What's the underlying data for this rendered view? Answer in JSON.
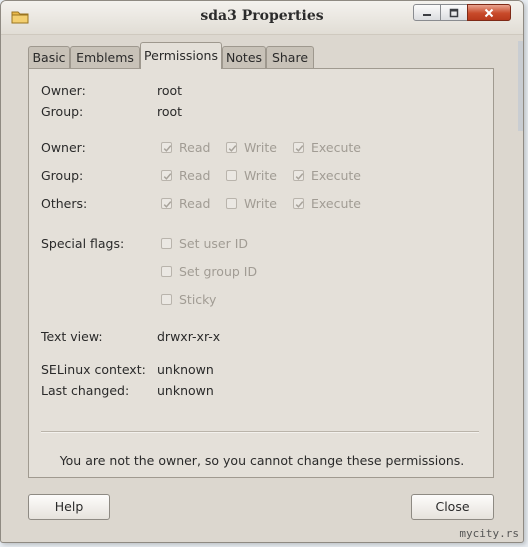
{
  "window": {
    "title": "sda3 Properties",
    "icon": "folder-icon",
    "controls": [
      "minimize-icon",
      "maximize-icon",
      "close-icon"
    ]
  },
  "tabs": [
    {
      "label": "Basic",
      "active": false
    },
    {
      "label": "Emblems",
      "active": false
    },
    {
      "label": "Permissions",
      "active": true
    },
    {
      "label": "Notes",
      "active": false
    },
    {
      "label": "Share",
      "active": false
    }
  ],
  "ownership": {
    "owner_label": "Owner:",
    "owner_value": "root",
    "group_label": "Group:",
    "group_value": "root"
  },
  "permissions": {
    "owner": {
      "label": "Owner:",
      "read": {
        "label": "Read",
        "checked": true
      },
      "write": {
        "label": "Write",
        "checked": true
      },
      "execute": {
        "label": "Execute",
        "checked": true
      }
    },
    "group": {
      "label": "Group:",
      "read": {
        "label": "Read",
        "checked": true
      },
      "write": {
        "label": "Write",
        "checked": false
      },
      "execute": {
        "label": "Execute",
        "checked": true
      }
    },
    "others": {
      "label": "Others:",
      "read": {
        "label": "Read",
        "checked": true
      },
      "write": {
        "label": "Write",
        "checked": false
      },
      "execute": {
        "label": "Execute",
        "checked": true
      }
    }
  },
  "special_flags": {
    "label": "Special flags:",
    "set_user_id": {
      "label": "Set user ID",
      "checked": false
    },
    "set_group_id": {
      "label": "Set group ID",
      "checked": false
    },
    "sticky": {
      "label": "Sticky",
      "checked": false
    }
  },
  "text_view": {
    "label": "Text view:",
    "value": "drwxr-xr-x"
  },
  "selinux": {
    "label": "SELinux context:",
    "value": "unknown"
  },
  "last_changed": {
    "label": "Last changed:",
    "value": "unknown"
  },
  "notice": "You are not the owner, so you cannot change these permissions.",
  "buttons": {
    "help": "Help",
    "close": "Close"
  },
  "watermark": "mycity.rs",
  "colors": {
    "dialog_bg": "#dcd7cf",
    "panel_bg": "#e4e0d9",
    "disabled_text": "#a19c94",
    "close_button": "#c84a2a"
  }
}
